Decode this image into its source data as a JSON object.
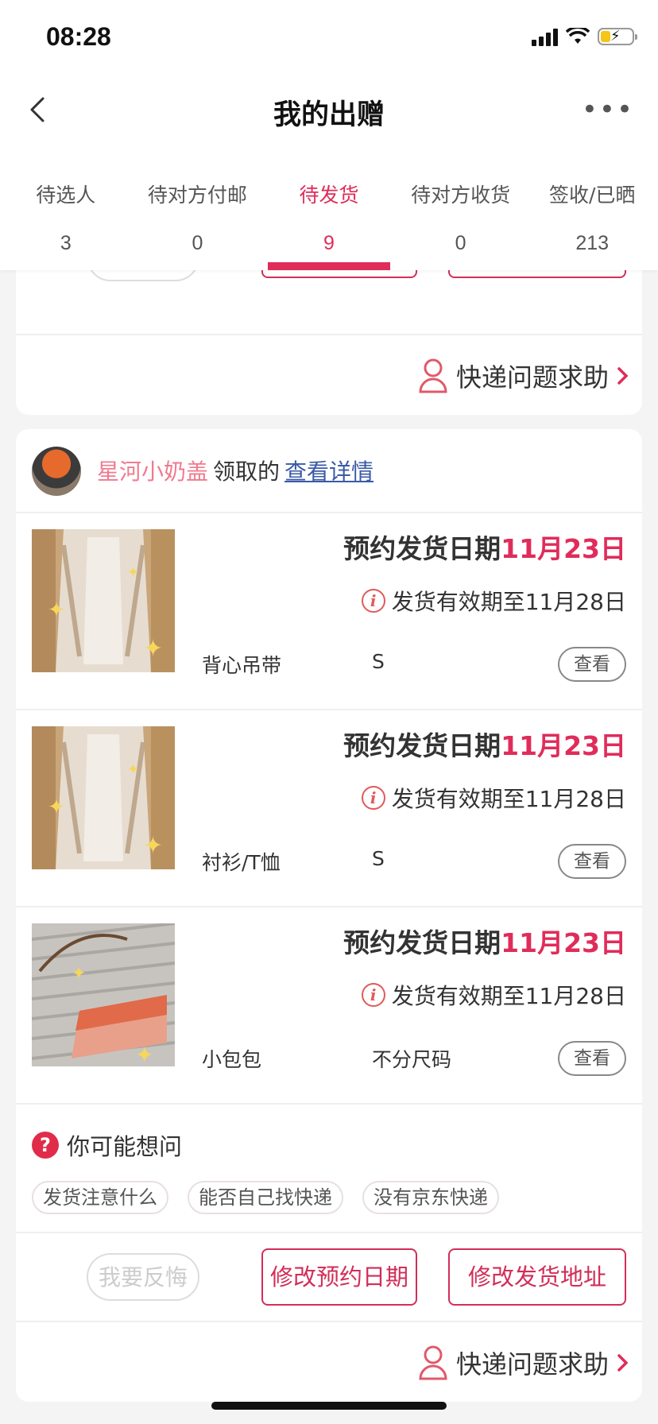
{
  "status_bar": {
    "time": "08:28"
  },
  "nav": {
    "title": "我的出赠"
  },
  "tabs": [
    {
      "label": "待选人",
      "count": "3"
    },
    {
      "label": "待对方付邮",
      "count": "0"
    },
    {
      "label": "待发货",
      "count": "9"
    },
    {
      "label": "待对方收货",
      "count": "0"
    },
    {
      "label": "签收/已晒",
      "count": "213"
    }
  ],
  "actions": {
    "regret": "我要反悔",
    "change_date": "修改预约日期",
    "change_address": "修改发货地址",
    "courier_help": "快递问题求助"
  },
  "order": {
    "donor_name": "星河小奶盖",
    "donor_verb": "领取的",
    "detail_link": "查看详情",
    "items": [
      {
        "ship_label": "预约发货日期",
        "ship_date": "11月23日",
        "validity": "发货有效期至11月28日",
        "category": "背心吊带",
        "size": "S",
        "view": "查看"
      },
      {
        "ship_label": "预约发货日期",
        "ship_date": "11月23日",
        "validity": "发货有效期至11月28日",
        "category": "衬衫/T恤",
        "size": "S",
        "view": "查看"
      },
      {
        "ship_label": "预约发货日期",
        "ship_date": "11月23日",
        "validity": "发货有效期至11月28日",
        "category": "小包包",
        "size": "不分尺码",
        "view": "查看"
      }
    ]
  },
  "faq": {
    "title": "你可能想问",
    "chips": [
      "发货注意什么",
      "能否自己找快递",
      "没有京东快递"
    ]
  },
  "colors": {
    "accent": "#e02c5a",
    "link": "#3a5aa8",
    "donor": "#f07a8e"
  }
}
